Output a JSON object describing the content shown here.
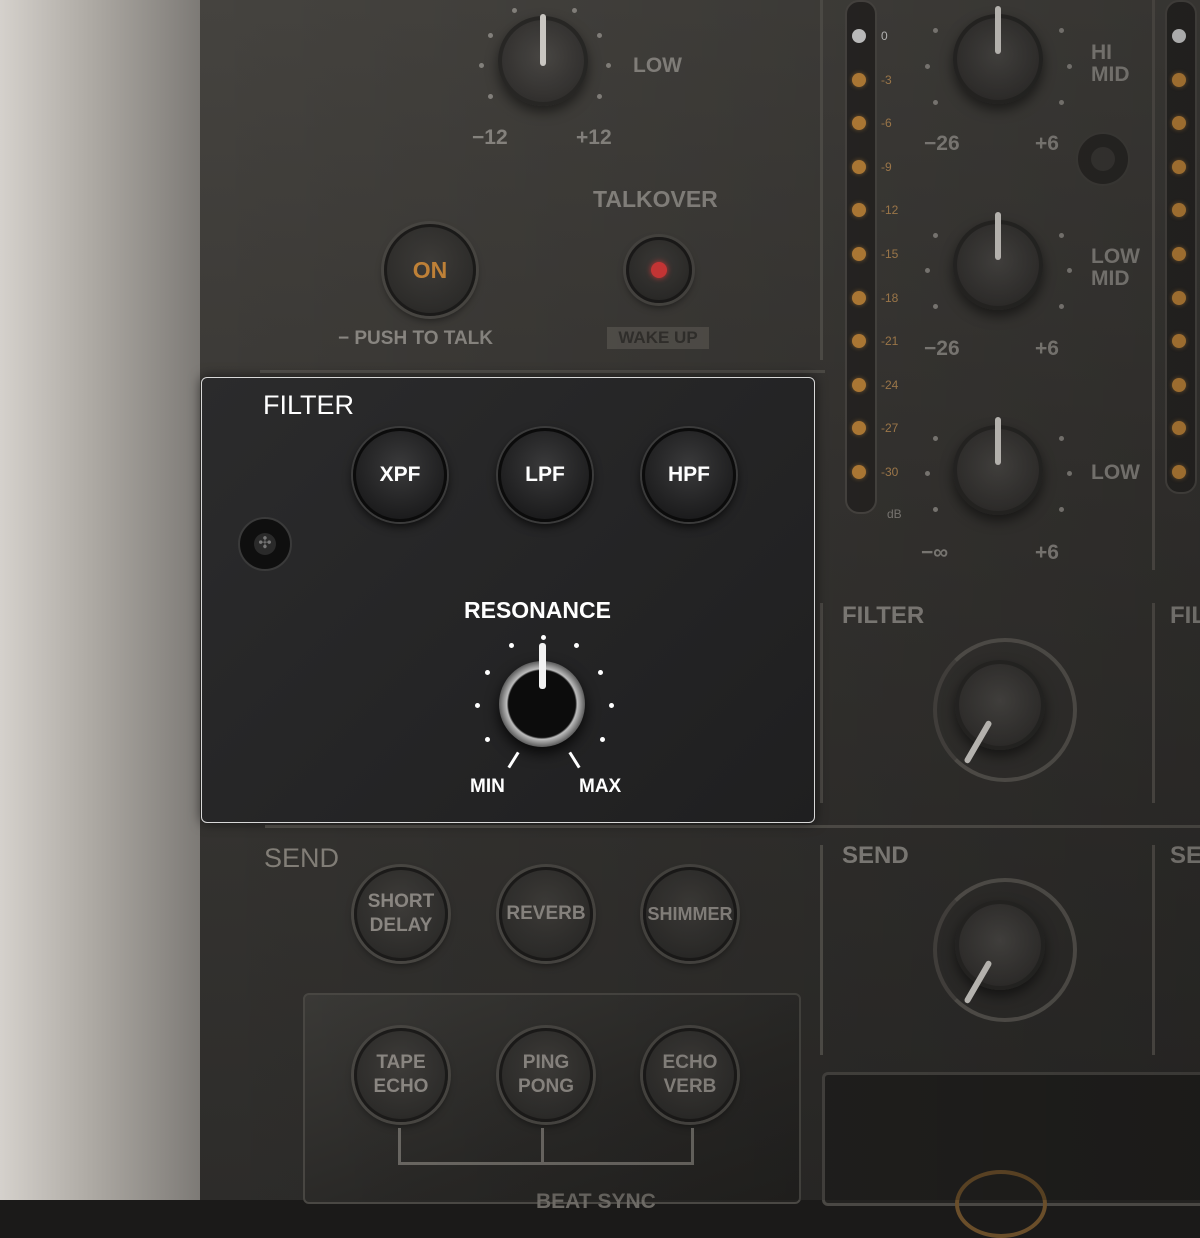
{
  "channel": {
    "low_label": "LOW",
    "eq_min": "−12",
    "eq_max": "+12",
    "talkover": {
      "title": "TALKOVER",
      "on_label": "ON",
      "push_to_talk": "PUSH TO TALK",
      "wake_up": "WAKE UP"
    },
    "filter": {
      "title": "FILTER",
      "buttons": [
        "XPF",
        "LPF",
        "HPF"
      ],
      "resonance_label": "RESONANCE",
      "min_label": "MIN",
      "max_label": "MAX"
    },
    "send": {
      "title": "SEND",
      "buttons": [
        [
          "SHORT",
          "DELAY"
        ],
        [
          "REVERB"
        ],
        [
          "SHIMMER"
        ]
      ],
      "sub_buttons": [
        [
          "TAPE",
          "ECHO"
        ],
        [
          "PING",
          "PONG"
        ],
        [
          "ECHO",
          "VERB"
        ]
      ],
      "sub_label_partial": "BEAT SYNC"
    }
  },
  "meter": {
    "scale": [
      "0",
      "-3",
      "-6",
      "-9",
      "-12",
      "-15",
      "-18",
      "-21",
      "-24",
      "-27",
      "-30"
    ],
    "unit": "dB"
  },
  "eq_strip": {
    "hi_mid": [
      "HI",
      "MID"
    ],
    "hi_mid_min": "−26",
    "hi_mid_max": "+6",
    "low_mid": [
      "LOW",
      "MID"
    ],
    "low_mid_min": "−26",
    "low_mid_max": "+6",
    "low": "LOW",
    "low_min": "−∞",
    "low_max": "+6"
  },
  "right_filter_label": "FILTER",
  "right_filter_partial": "FIL",
  "right_send_label": "SEND",
  "right_send_partial": "SE",
  "colors": {
    "accent_led": "#c68a3c",
    "on_text": "#c8873a",
    "talkover_led": "#d93a3a",
    "filter_panel_border": "#d8d8d8"
  }
}
